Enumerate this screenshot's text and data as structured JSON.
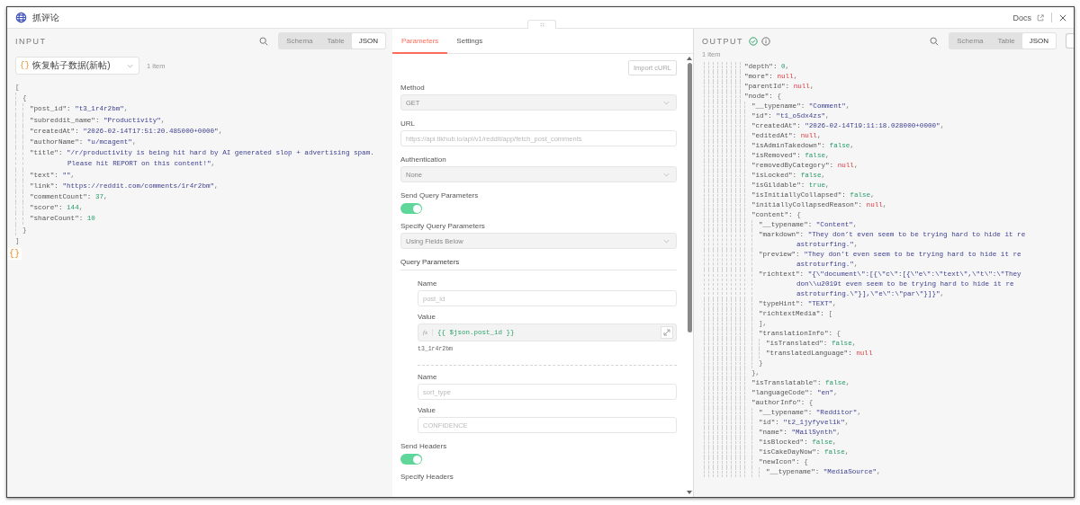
{
  "window": {
    "title": "抓评论",
    "docs_link": "Docs",
    "side_badge": "{}"
  },
  "input": {
    "heading": "INPUT",
    "view_tabs": [
      {
        "label": "Schema",
        "selected": false
      },
      {
        "label": "Table",
        "selected": false
      },
      {
        "label": "JSON",
        "selected": true
      }
    ],
    "node_select": {
      "icon": "{}",
      "value": "恢复帖子数据(新帖)"
    },
    "item_count": "1 item",
    "json": [
      {
        "open": "[",
        "close": "]",
        "children": [
          {
            "open": "{",
            "close": "}",
            "children": [
              {
                "key": "\"post_id\":",
                "value": "\"t3_1r4r2bm\"",
                "kind": "string",
                "punct": ","
              },
              {
                "key": "\"subreddit_name\":",
                "value": "\"Productivity\"",
                "kind": "string",
                "punct": ","
              },
              {
                "key": "\"createdAt\":",
                "value": "\"2026-02-14T17:51:20.485000+0000\"",
                "kind": "string",
                "punct": ","
              },
              {
                "key": "\"authorName\":",
                "value": "\"u/mcagent\"",
                "kind": "string",
                "punct": ","
              },
              {
                "key": "\"title\":",
                "value": "\"/r/productivity is being hit hard by AI generated slop + advertising spam. Please hit REPORT on this content!\"",
                "kind": "string",
                "punct": ","
              },
              {
                "key": "\"text\":",
                "value": "\"\"",
                "kind": "string",
                "punct": ","
              },
              {
                "key": "\"link\":",
                "value": "\"https://reddit.com/comments/1r4r2bm\"",
                "kind": "string",
                "punct": ","
              },
              {
                "key": "\"commentCount\":",
                "value": "37",
                "kind": "number",
                "punct": ","
              },
              {
                "key": "\"score\":",
                "value": "144",
                "kind": "number",
                "punct": ","
              },
              {
                "key": "\"shareCount\":",
                "value": "10",
                "kind": "number"
              }
            ]
          }
        ]
      }
    ]
  },
  "parameters": {
    "tabs": [
      {
        "label": "Parameters",
        "selected": true
      },
      {
        "label": "Settings",
        "selected": false
      }
    ],
    "import_button": "Import cURL",
    "fields": [
      {
        "kind": "select",
        "label": "Method",
        "value": "GET"
      },
      {
        "kind": "text",
        "label": "URL",
        "placeholder": "https://api.tikhub.io/api/v1/reddit/app/fetch_post_comments"
      },
      {
        "kind": "select",
        "label": "Authentication",
        "value": "None"
      },
      {
        "kind": "toggle",
        "label": "Send Query Parameters",
        "on": true
      },
      {
        "kind": "select",
        "label": "Specify Query Parameters",
        "value": "Using Fields Below"
      },
      {
        "kind": "params",
        "label": "Query Parameters",
        "items": [
          {
            "name_label": "Name",
            "name_placeholder": "post_id",
            "value_label": "Value",
            "kind": "expression",
            "fx": "fx",
            "value": "{{ $json.post_id }}",
            "preview": "t3_1r4r2bm"
          },
          {
            "name_label": "Name",
            "name_placeholder": "sort_type",
            "value_label": "Value",
            "kind": "text",
            "value_placeholder": "CONFIDENCE"
          }
        ]
      },
      {
        "kind": "toggle",
        "label": "Send Headers",
        "on": true
      },
      {
        "kind": "heading",
        "label": "Specify Headers"
      }
    ]
  },
  "output": {
    "heading": "OUTPUT",
    "view_tabs": [
      {
        "label": "Schema",
        "selected": false
      },
      {
        "label": "Table",
        "selected": false
      },
      {
        "label": "JSON",
        "selected": true
      }
    ],
    "item_count": "1 item",
    "json": [
      {
        "key": "\"depth\":",
        "value": "0",
        "kind": "number",
        "punct": ","
      },
      {
        "key": "\"more\":",
        "value": "null",
        "kind": "null",
        "punct": ","
      },
      {
        "key": "\"parentId\":",
        "value": "null",
        "kind": "null",
        "punct": ","
      },
      {
        "key": "\"node\":",
        "open": "{",
        "children": [
          {
            "key": "\"__typename\":",
            "value": "\"Comment\"",
            "kind": "string",
            "punct": ","
          },
          {
            "key": "\"id\":",
            "value": "\"t1_o5dx4zs\"",
            "kind": "string",
            "punct": ","
          },
          {
            "key": "\"createdAt\":",
            "value": "\"2026-02-14T19:11:18.028000+0000\"",
            "kind": "string",
            "punct": ","
          },
          {
            "key": "\"editedAt\":",
            "value": "null",
            "kind": "null",
            "punct": ","
          },
          {
            "key": "\"isAdminTakedown\":",
            "value": "false",
            "kind": "boolean",
            "punct": ","
          },
          {
            "key": "\"isRemoved\":",
            "value": "false",
            "kind": "boolean",
            "punct": ","
          },
          {
            "key": "\"removedByCategory\":",
            "value": "null",
            "kind": "null",
            "punct": ","
          },
          {
            "key": "\"isLocked\":",
            "value": "false",
            "kind": "boolean",
            "punct": ","
          },
          {
            "key": "\"isGildable\":",
            "value": "true",
            "kind": "boolean",
            "punct": ","
          },
          {
            "key": "\"isInitiallyCollapsed\":",
            "value": "false",
            "kind": "boolean",
            "punct": ","
          },
          {
            "key": "\"initiallyCollapsedReason\":",
            "value": "null",
            "kind": "null",
            "punct": ","
          },
          {
            "key": "\"content\":",
            "open": "{",
            "close": "},",
            "children": [
              {
                "key": "\"__typename\":",
                "value": "\"Content\"",
                "kind": "string",
                "punct": ","
              },
              {
                "key": "\"markdown\":",
                "value": "\"They don’t even seem to be trying hard to hide it re astroturfing.\"",
                "kind": "string",
                "punct": ","
              },
              {
                "key": "\"preview\":",
                "value": "\"They don’t even seem to be trying hard to hide it re astroturfing.\"",
                "kind": "string",
                "punct": ","
              },
              {
                "key": "\"richtext\":",
                "value": "\"{\\\"document\\\":[{\\\"c\\\":[{\\\"e\\\":\\\"text\\\",\\\"t\\\":\\\"They don\\\\u2019t even seem to be trying hard to hide it re astroturfing.\\\"}],\\\"e\\\":\\\"par\\\"}]}\"",
                "kind": "string",
                "punct": ","
              },
              {
                "key": "\"typeHint\":",
                "value": "\"TEXT\"",
                "kind": "string",
                "punct": ","
              },
              {
                "key": "\"richtextMedia\":",
                "open": "[",
                "close": "],"
              },
              {
                "key": "\"translationInfo\":",
                "open": "{",
                "close": "}",
                "children": [
                  {
                    "key": "\"isTranslated\":",
                    "value": "false",
                    "kind": "boolean",
                    "punct": ","
                  },
                  {
                    "key": "\"translatedLanguage\":",
                    "value": "null",
                    "kind": "null"
                  }
                ]
              }
            ]
          },
          {
            "key": "\"isTranslatable\":",
            "value": "false",
            "kind": "boolean",
            "punct": ","
          },
          {
            "key": "\"languageCode\":",
            "value": "\"en\"",
            "kind": "string",
            "punct": ","
          },
          {
            "key": "\"authorInfo\":",
            "open": "{",
            "children": [
              {
                "key": "\"__typename\":",
                "value": "\"Redditor\"",
                "kind": "string",
                "punct": ","
              },
              {
                "key": "\"id\":",
                "value": "\"t2_1jyfyvel1k\"",
                "kind": "string",
                "punct": ","
              },
              {
                "key": "\"name\":",
                "value": "\"MailSynth\"",
                "kind": "string",
                "punct": ","
              },
              {
                "key": "\"isBlocked\":",
                "value": "false",
                "kind": "boolean",
                "punct": ","
              },
              {
                "key": "\"isCakeDayNow\":",
                "value": "false",
                "kind": "boolean",
                "punct": ","
              },
              {
                "key": "\"newIcon\":",
                "open": "{",
                "children": [
                  {
                    "key": "\"__typename\":",
                    "value": "\"MediaSource\"",
                    "kind": "string",
                    "punct": ","
                  }
                ]
              }
            ]
          }
        ]
      }
    ]
  }
}
